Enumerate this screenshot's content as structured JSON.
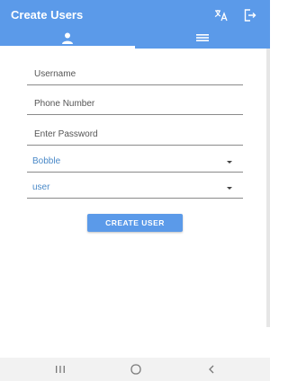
{
  "app_bar": {
    "title": "Create Users",
    "icons": [
      "translate-icon",
      "logout-icon"
    ]
  },
  "tabs": [
    {
      "name": "user-tab",
      "icon": "person-icon",
      "selected": true
    },
    {
      "name": "list-tab",
      "icon": "list-icon",
      "selected": false
    }
  ],
  "form": {
    "username_placeholder": "Username",
    "phone_placeholder": "Phone Number",
    "password_placeholder": "Enter Password",
    "select_1_value": "Bobble",
    "select_2_value": "user",
    "submit_label": "CREATE USER"
  },
  "nav_bar": {
    "icons": [
      "recent-apps-icon",
      "home-icon",
      "back-icon"
    ]
  },
  "colors": {
    "primary": "#5b9ae9",
    "select_text": "#4a89c8"
  }
}
